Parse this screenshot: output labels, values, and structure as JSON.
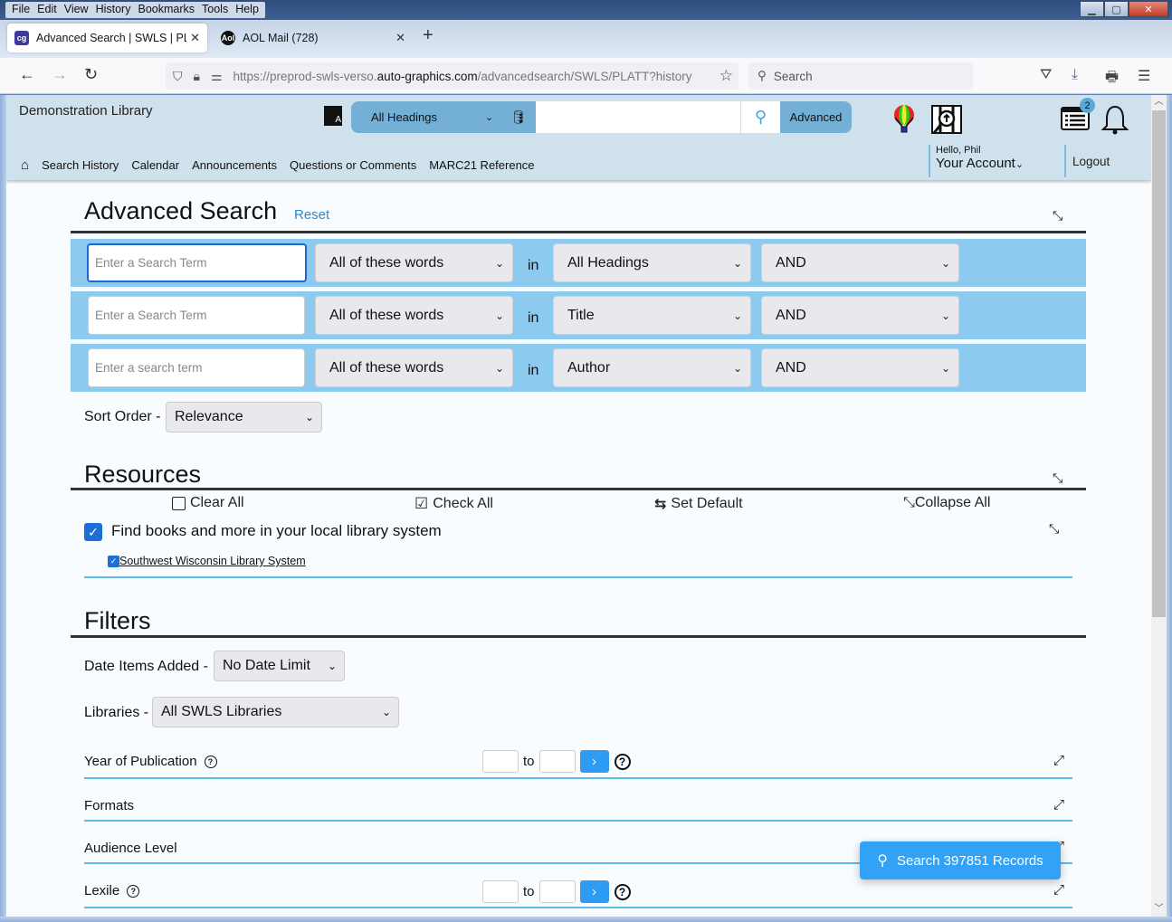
{
  "browser": {
    "menu": [
      "File",
      "Edit",
      "View",
      "History",
      "Bookmarks",
      "Tools",
      "Help"
    ],
    "tabs": [
      {
        "label": "Advanced Search | SWLS | PLATT",
        "favicon": "cg",
        "active": true
      },
      {
        "label": "AOL Mail (728)",
        "favicon": "Aol",
        "active": false
      }
    ],
    "url_prefix": "https://preprod-swls-verso.",
    "url_domain": "auto-graphics.com",
    "url_suffix": "/advancedsearch/SWLS/PLATT?history",
    "search_placeholder": "Search"
  },
  "header": {
    "library_name": "Demonstration Library",
    "search_scope": "All Headings",
    "search_value": "",
    "advanced_label": "Advanced",
    "notifications_count": "2",
    "nav": [
      "Search History",
      "Calendar",
      "Announcements",
      "Questions or Comments",
      "MARC21 Reference"
    ],
    "greeting": "Hello, Phil",
    "account_label": "Your Account",
    "logout_label": "Logout"
  },
  "advanced": {
    "title": "Advanced Search",
    "reset_label": "Reset",
    "in_label": "in",
    "rows": [
      {
        "placeholder": "Enter a Search Term",
        "match": "All of these words",
        "field": "All Headings",
        "op": "AND"
      },
      {
        "placeholder": "Enter a Search Term",
        "match": "All of these words",
        "field": "Title",
        "op": "AND"
      },
      {
        "placeholder": "Enter a search term",
        "match": "All of these words",
        "field": "Author",
        "op": "AND"
      }
    ],
    "sort_label": "Sort Order -",
    "sort_value": "Relevance"
  },
  "resources": {
    "title": "Resources",
    "clear_all": "Clear All",
    "check_all": "Check All",
    "set_default": "Set Default",
    "collapse_all": "Collapse All",
    "group_label": "Find books and more in your local library system",
    "group_checked": true,
    "items": [
      {
        "label": "Southwest Wisconsin Library System",
        "checked": true
      }
    ]
  },
  "filters": {
    "title": "Filters",
    "date_label": "Date Items Added -",
    "date_value": "No Date Limit",
    "libraries_label": "Libraries -",
    "libraries_value": "All SWLS Libraries",
    "year_label": "Year of Publication",
    "to_label": "to",
    "formats_label": "Formats",
    "audience_label": "Audience Level",
    "lexile_label": "Lexile"
  },
  "search_button": "Search 397851 Records"
}
